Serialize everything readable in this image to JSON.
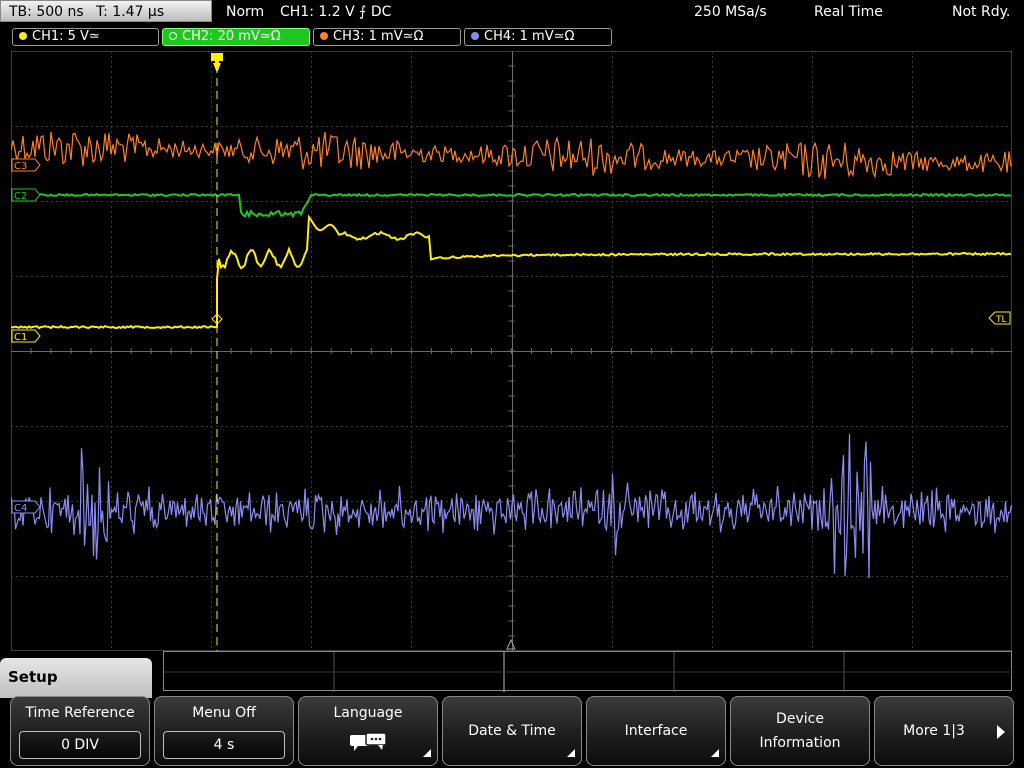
{
  "status_bar": {
    "timebase": "TB: 500 ns",
    "trigger_time": "T: 1.47 µs",
    "trigger_mode": "Norm",
    "trigger_info": "CH1: 1.2 V ⨍ DC",
    "sample_rate": "250 MSa/s",
    "acq_mode": "Real Time",
    "run_state": "Not Rdy."
  },
  "channels": [
    {
      "label": "CH1: 5 V≃",
      "color": "#ffeb10"
    },
    {
      "label": "CH2: 20 mV≃Ω",
      "color": "#1ec81e"
    },
    {
      "label": "CH3: 1 mV≃Ω",
      "color": "#ff7f2a"
    },
    {
      "label": "CH4: 1 mV≃Ω",
      "color": "#8c8cf0"
    }
  ],
  "markers": {
    "c1": "C1",
    "c2": "C2",
    "c3": "C3",
    "c4": "C4",
    "tl": "TL"
  },
  "menu": {
    "title": "Setup",
    "keys": [
      {
        "label": "Time Reference",
        "value": "0 DIV"
      },
      {
        "label": "Menu Off",
        "value": "4 s"
      },
      {
        "label": "Language"
      },
      {
        "label": "Date & Time"
      },
      {
        "label": "Interface"
      },
      {
        "label": "Device Information"
      },
      {
        "label": "More 1|3"
      }
    ]
  },
  "icons": [
    "language-speech-bubbles-icon",
    "submenu-corner-icon",
    "next-page-arrow-icon",
    "trigger-position-marker-icon",
    "trigger-level-marker-icon"
  ],
  "colors": {
    "grid": "#5a5a5a",
    "ch1": "#ffeb10",
    "ch2": "#1ec81e",
    "ch3": "#ff7f2a",
    "ch4": "#8c8cf0"
  }
}
